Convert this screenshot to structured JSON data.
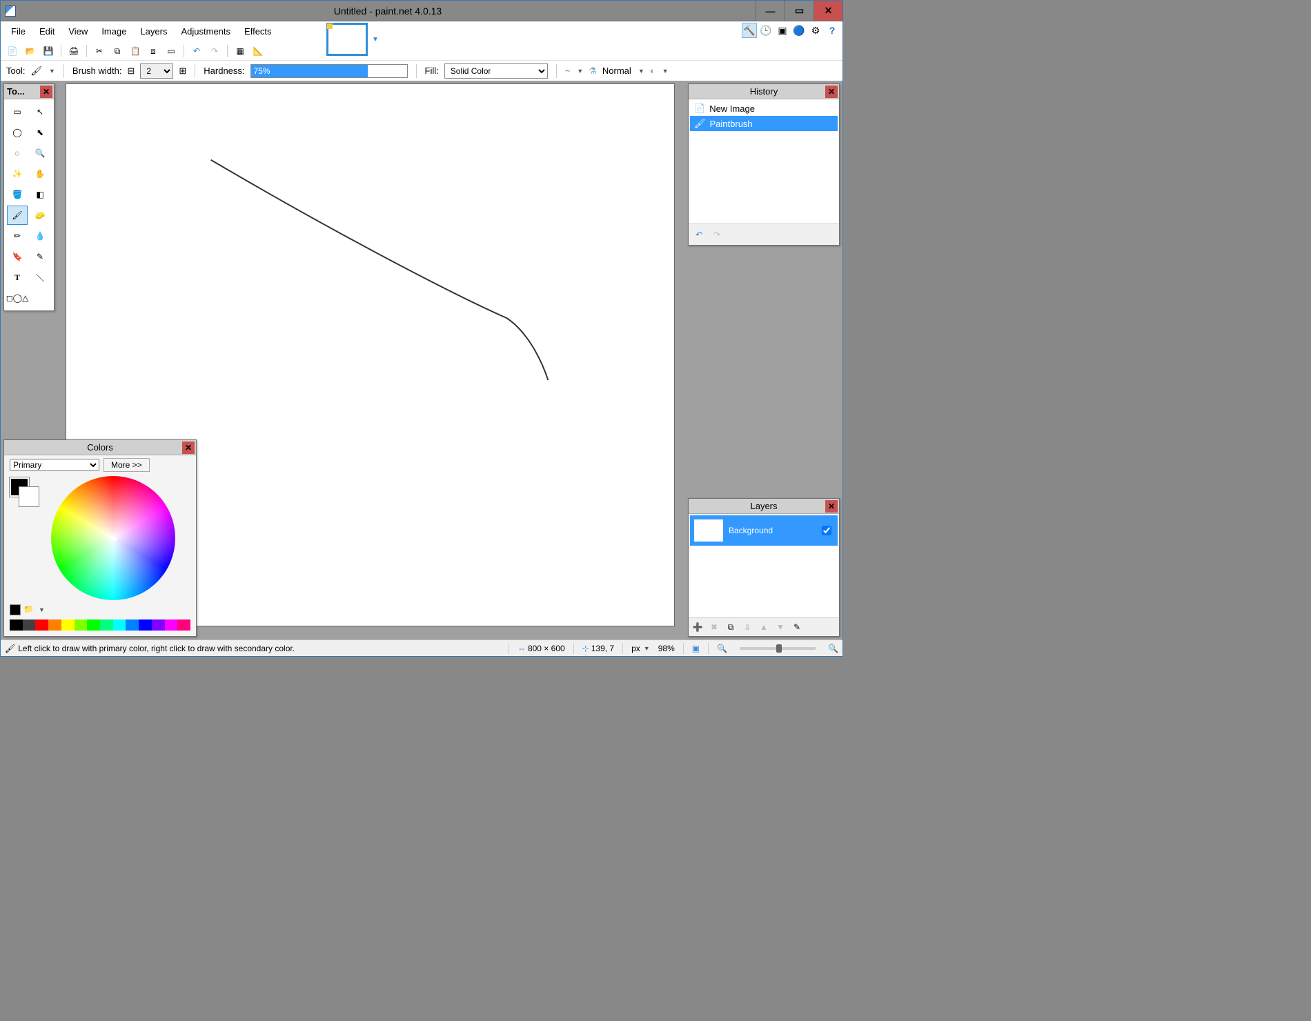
{
  "title": "Untitled - paint.net 4.0.13",
  "menu": [
    "File",
    "Edit",
    "View",
    "Image",
    "Layers",
    "Adjustments",
    "Effects"
  ],
  "toolbar": {
    "tool_label": "Tool:",
    "brushwidth_label": "Brush width:",
    "brushwidth_value": "2",
    "hardness_label": "Hardness:",
    "hardness_value": "75%",
    "fill_label": "Fill:",
    "fill_value": "Solid Color",
    "blend_mode": "Normal"
  },
  "tools_panel": {
    "title": "To..."
  },
  "history": {
    "title": "History",
    "items": [
      {
        "label": "New Image",
        "selected": false
      },
      {
        "label": "Paintbrush",
        "selected": true
      }
    ]
  },
  "layers": {
    "title": "Layers",
    "items": [
      {
        "name": "Background",
        "visible": true,
        "selected": true
      }
    ]
  },
  "colors": {
    "title": "Colors",
    "selector": "Primary",
    "more": "More >>",
    "black_white": [
      "#000",
      "#fff"
    ],
    "palette": [
      "#000",
      "#404040",
      "#ff0000",
      "#ff8000",
      "#ffff00",
      "#80ff00",
      "#00ff00",
      "#00ff80",
      "#00ffff",
      "#0080ff",
      "#0000ff",
      "#8000ff",
      "#ff00ff",
      "#ff0080"
    ]
  },
  "status": {
    "hint": "Left click to draw with primary color, right click to draw with secondary color.",
    "canvas_size": "800 × 600",
    "cursor_pos": "139, 7",
    "unit": "px",
    "zoom": "98%"
  }
}
